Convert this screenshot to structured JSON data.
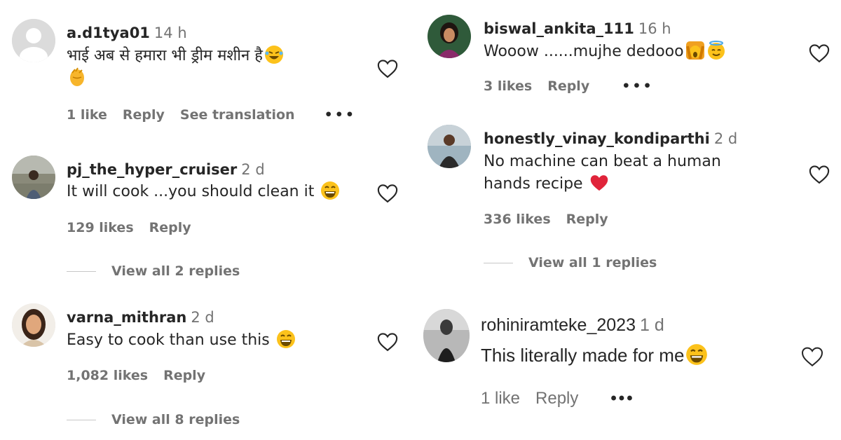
{
  "left": [
    {
      "username": "a.d1tya01",
      "time": "14 h",
      "text": "भाई अब से हमारा भी ड्रीम मशीन है",
      "likes": "1 like",
      "reply": "Reply",
      "translate": "See translation",
      "more": "•••",
      "emojis": [
        "rofl-emoji",
        "clap-emoji"
      ]
    },
    {
      "username": "pj_the_hyper_cruiser",
      "time": "2 d",
      "text": "It will cook ...you should clean it",
      "likes": "129 likes",
      "reply": "Reply",
      "view_replies": "View all 2 replies",
      "emojis": [
        "laugh-emoji"
      ]
    },
    {
      "username": "varna_mithran",
      "time": "2 d",
      "text": "Easy to cook than use this",
      "likes": "1,082 likes",
      "reply": "Reply",
      "view_replies": "View all 8 replies",
      "emojis": [
        "laugh-emoji"
      ]
    }
  ],
  "right": [
    {
      "username": "biswal_ankita_111",
      "time": "16 h",
      "text": "Wooow ......mujhe dedooo",
      "likes": "3 likes",
      "reply": "Reply",
      "more": "•••",
      "emojis": [
        "wow-hands-emoji",
        "halo-emoji"
      ]
    },
    {
      "username": "honestly_vinay_kondiparthi",
      "time": "2 d",
      "text_line1": "No machine can beat a human",
      "text_line2": "hands recipe",
      "likes": "336 likes",
      "reply": "Reply",
      "view_replies": "View all 1 replies",
      "emojis": [
        "red-heart-emoji"
      ]
    },
    {
      "username": "rohiniramteke_2023",
      "time": "1 d",
      "text": "This literally made for me",
      "likes": "1 like",
      "reply": "Reply",
      "more": "•••",
      "emojis": [
        "laugh-emoji"
      ]
    }
  ],
  "colors": {
    "text": "#262626",
    "secondary": "#737373",
    "heart_red": "#e0243a",
    "emoji_yellow": "#fcc21b"
  }
}
